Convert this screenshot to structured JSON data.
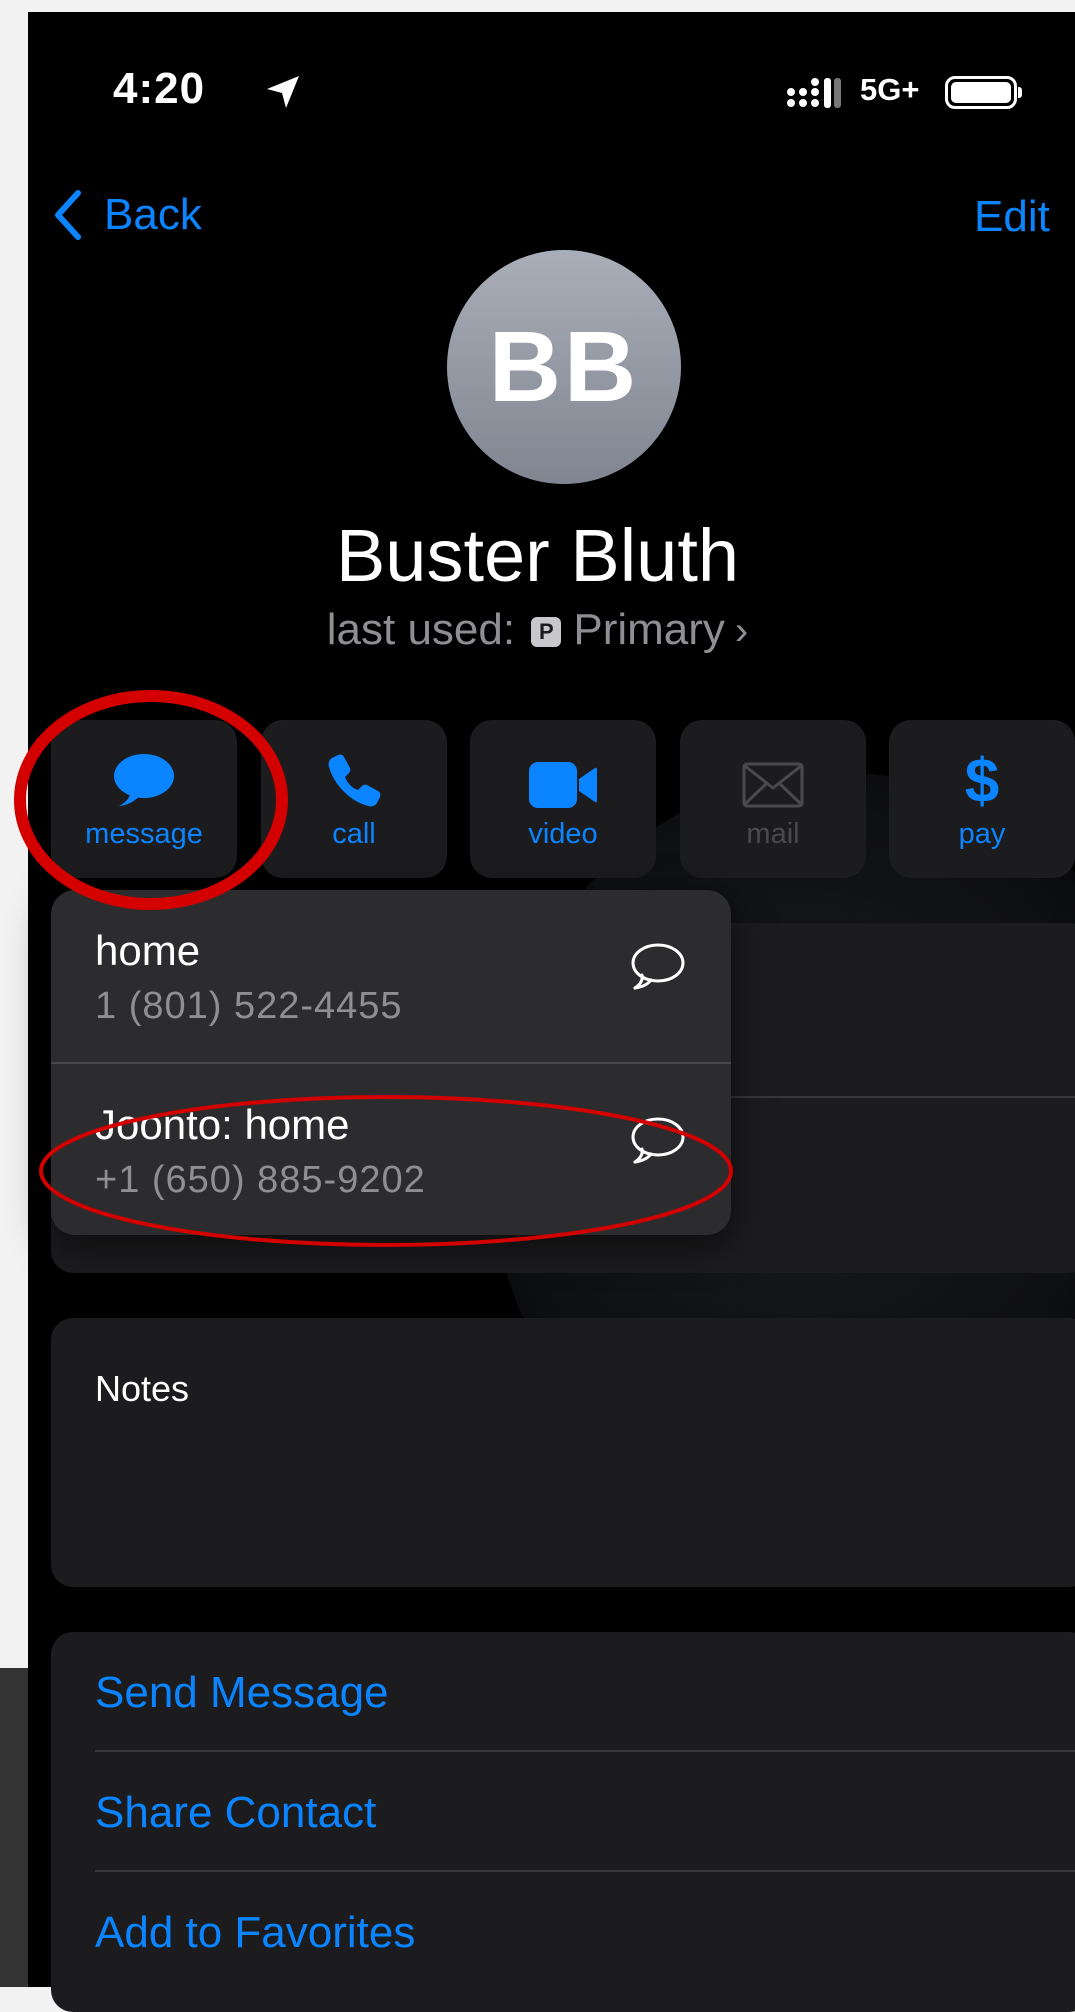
{
  "status_bar": {
    "time": "4:20",
    "network": "5G+"
  },
  "nav": {
    "back_label": "Back",
    "edit_label": "Edit"
  },
  "contact": {
    "initials": "BB",
    "name": "Buster Bluth",
    "last_used_prefix": "last used:",
    "last_used_badge": "P",
    "last_used_value": "Primary",
    "chevron": "›"
  },
  "actions": [
    {
      "label": "message",
      "icon": "message-bubble-icon",
      "enabled": true
    },
    {
      "label": "call",
      "icon": "phone-icon",
      "enabled": true
    },
    {
      "label": "video",
      "icon": "video-camera-icon",
      "enabled": true
    },
    {
      "label": "mail",
      "icon": "envelope-icon",
      "enabled": false
    },
    {
      "label": "pay",
      "icon": "dollar-icon",
      "enabled": true
    }
  ],
  "message_menu": [
    {
      "label": "home",
      "number": "1 (801) 522-4455",
      "icon": "message-bubble-outline-icon"
    },
    {
      "label": "Joonto: home",
      "number": "+1 (650) 885-9202",
      "icon": "message-bubble-outline-icon"
    }
  ],
  "notes": {
    "label": "Notes"
  },
  "links": {
    "send_message": "Send Message",
    "share_contact": "Share Contact",
    "add_to_favorites": "Add to Favorites"
  },
  "colors": {
    "accent": "#0a84ff",
    "background": "#000000",
    "card": "#1c1c1e",
    "popup": "#2c2c2e",
    "annotation": "#d40000"
  }
}
